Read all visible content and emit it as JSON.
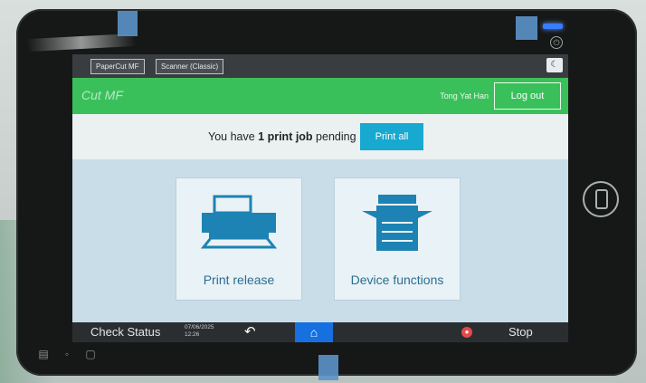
{
  "screen": {
    "top_tabs": [
      "PaperCut MF",
      "Scanner (Classic)"
    ],
    "brand": "Cut MF",
    "user_name": "Tong Yat Han",
    "logout_label": "Log out",
    "pending": {
      "prefix": "You have ",
      "count_text": "1 print job",
      "suffix": " pending",
      "print_all_label": "Print all"
    },
    "tiles": [
      {
        "label": "Print release",
        "icon": "printer-icon"
      },
      {
        "label": "Device functions",
        "icon": "copier-icon"
      }
    ],
    "bottom": {
      "check_status_label": "Check Status",
      "date": "07/06/2025",
      "time": "12:26",
      "back_icon": "back-arrow-icon",
      "home_icon": "home-icon",
      "stop_label": "Stop"
    }
  },
  "colors": {
    "green_bar": "#3ac05b",
    "print_all": "#17a9d0",
    "home_button": "#1670e0",
    "tile_text": "#2a6e92"
  }
}
